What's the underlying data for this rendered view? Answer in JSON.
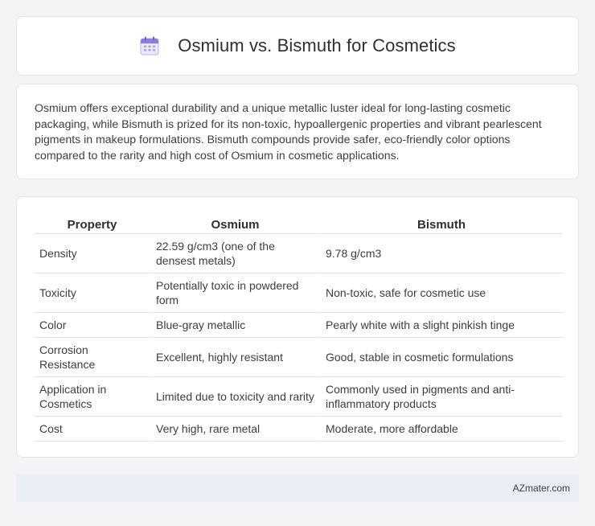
{
  "header": {
    "icon": "calendar-icon",
    "title": "Osmium vs. Bismuth for Cosmetics"
  },
  "summary": {
    "text": "Osmium offers exceptional durability and a unique metallic luster ideal for long-lasting cosmetic packaging, while Bismuth is prized for its non-toxic, hypoallergenic properties and vibrant pearlescent pigments in makeup formulations. Bismuth compounds provide safer, eco-friendly color options compared to the rarity and high cost of Osmium in cosmetic applications."
  },
  "table": {
    "headers": [
      "Property",
      "Osmium",
      "Bismuth"
    ],
    "rows": [
      [
        "Density",
        "22.59 g/cm3 (one of the densest metals)",
        "9.78 g/cm3"
      ],
      [
        "Toxicity",
        "Potentially toxic in powdered form",
        "Non-toxic, safe for cosmetic use"
      ],
      [
        "Color",
        "Blue-gray metallic",
        "Pearly white with a slight pinkish tinge"
      ],
      [
        "Corrosion Resistance",
        "Excellent, highly resistant",
        "Good, stable in cosmetic formulations"
      ],
      [
        "Application in Cosmetics",
        "Limited due to toxicity and rarity",
        "Commonly used in pigments and anti-inflammatory products"
      ],
      [
        "Cost",
        "Very high, rare metal",
        "Moderate, more affordable"
      ]
    ]
  },
  "footer": {
    "text": "AZmater.com"
  },
  "colors": {
    "page_background": "#f3f4f6",
    "footer_background": "#e8edf6",
    "icon_accent": "#8b7fd6"
  }
}
